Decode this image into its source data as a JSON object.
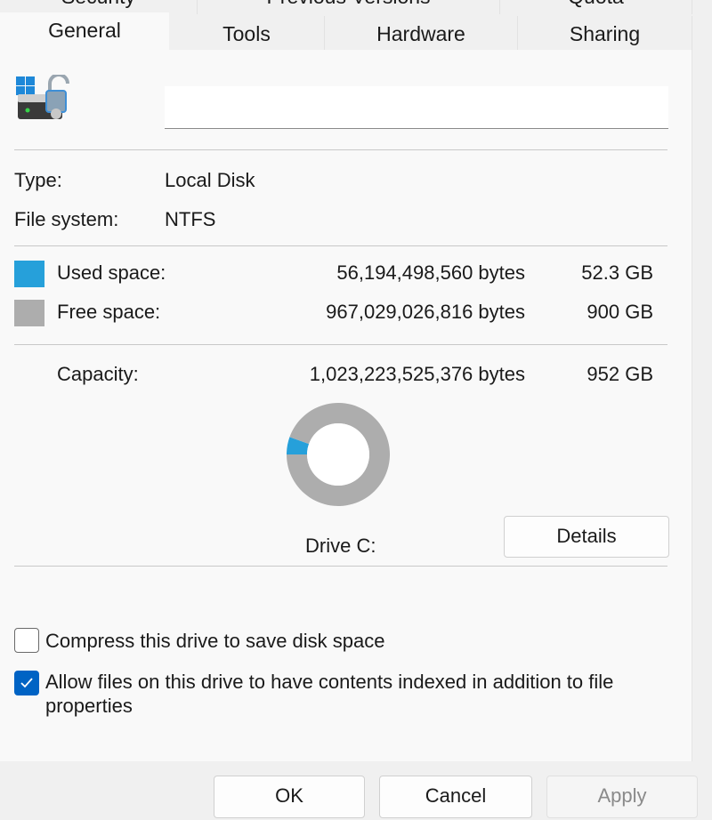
{
  "tabs_row1": [
    {
      "label": "Security"
    },
    {
      "label": "Previous Versions"
    },
    {
      "label": "Quota"
    }
  ],
  "tabs_row2": [
    {
      "label": "General",
      "selected": true
    },
    {
      "label": "Tools"
    },
    {
      "label": "Hardware"
    },
    {
      "label": "Sharing"
    }
  ],
  "drive_icon": "drive-lock-icon",
  "name_input": {
    "value": ""
  },
  "type": {
    "label": "Type:",
    "value": "Local Disk"
  },
  "file_system": {
    "label": "File system:",
    "value": "NTFS"
  },
  "used": {
    "label": "Used space:",
    "bytes": "56,194,498,560 bytes",
    "size": "52.3 GB",
    "color": "#26a0da"
  },
  "free": {
    "label": "Free space:",
    "bytes": "967,029,026,816 bytes",
    "size": "900 GB",
    "color": "#adadad"
  },
  "capacity": {
    "label": "Capacity:",
    "bytes": "1,023,223,525,376 bytes",
    "size": "952 GB"
  },
  "chart_data": {
    "type": "pie",
    "style": "donut",
    "values": [
      {
        "name": "Used space",
        "value": 52.3
      },
      {
        "name": "Free space",
        "value": 900
      }
    ],
    "colors": [
      "#26a0da",
      "#adadad"
    ]
  },
  "drive_label": "Drive C:",
  "details_label": "Details",
  "compress": {
    "label": "Compress this drive to save disk space",
    "checked": false
  },
  "index": {
    "label": "Allow files on this drive to have contents indexed in addition to file properties",
    "checked": true
  },
  "buttons": {
    "ok": "OK",
    "cancel": "Cancel",
    "apply": "Apply"
  }
}
